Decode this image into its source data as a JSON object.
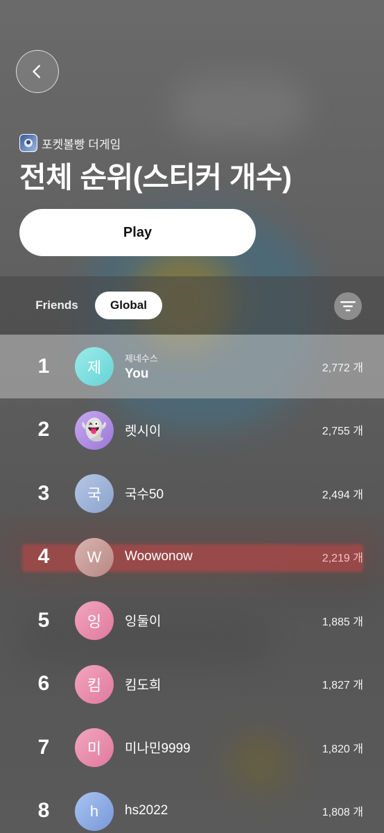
{
  "header": {
    "game_name": "포켓볼빵 더게임",
    "title": "전체 순위(스티커 개수)",
    "play_label": "Play"
  },
  "tabs": {
    "friends": "Friends",
    "global": "Global",
    "active": "Global"
  },
  "icons": {
    "back": "chevron-left-icon",
    "filter": "filter-lines-icon",
    "game": "game-app-icon"
  },
  "leaderboard": [
    {
      "rank": "1",
      "avatar_text": "제",
      "nickname": "제네수스",
      "name": "You",
      "score": "2,772 개"
    },
    {
      "rank": "2",
      "avatar_text": "👻",
      "name": "렛시이",
      "score": "2,755 개"
    },
    {
      "rank": "3",
      "avatar_text": "국",
      "name": "국수50",
      "score": "2,494 개"
    },
    {
      "rank": "4",
      "avatar_text": "W",
      "name": "Woowonow",
      "score": "2,219 개"
    },
    {
      "rank": "5",
      "avatar_text": "잉",
      "name": "잉둘이",
      "score": "1,885 개"
    },
    {
      "rank": "6",
      "avatar_text": "킴",
      "name": "킴도희",
      "score": "1,827 개"
    },
    {
      "rank": "7",
      "avatar_text": "미",
      "name": "미나민9999",
      "score": "1,820 개"
    },
    {
      "rank": "8",
      "avatar_text": "h",
      "name": "hs2022",
      "score": "1,808 개"
    }
  ],
  "colors": {
    "highlight_row": "#bebebe",
    "active_tab_bg": "#ffffff",
    "play_button_bg": "#ffffff"
  }
}
